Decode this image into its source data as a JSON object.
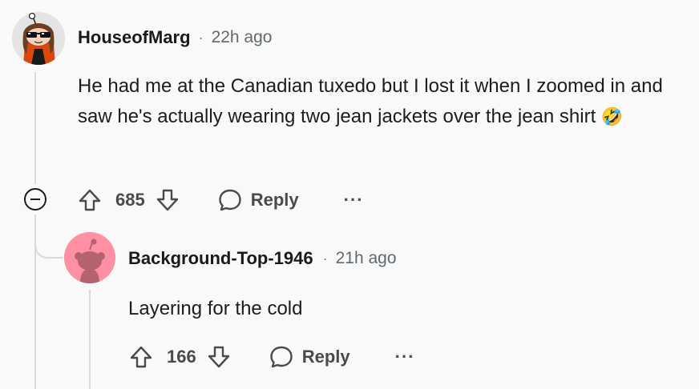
{
  "comments": [
    {
      "username": "HouseofMarg",
      "separator": "·",
      "time": "22h ago",
      "body": "He had me at the Canadian tuxedo but I lost it when I zoomed in and saw he's actually wearing two jean jackets over the jean shirt",
      "emoji": "🤣",
      "score": "685",
      "reply_label": "Reply",
      "more_label": "···",
      "avatar_icon": "snoo-avatar-sunglasses-icon"
    },
    {
      "username": "Background-Top-1946",
      "separator": "·",
      "time": "21h ago",
      "body": "Layering for the cold",
      "score": "166",
      "reply_label": "Reply",
      "more_label": "···",
      "avatar_icon": "default-snoo-avatar-icon"
    }
  ],
  "colors": {
    "background": "#f9f9f9",
    "thread_line": "#d7dadc",
    "default_avatar_bg": "#ff8fa3"
  }
}
